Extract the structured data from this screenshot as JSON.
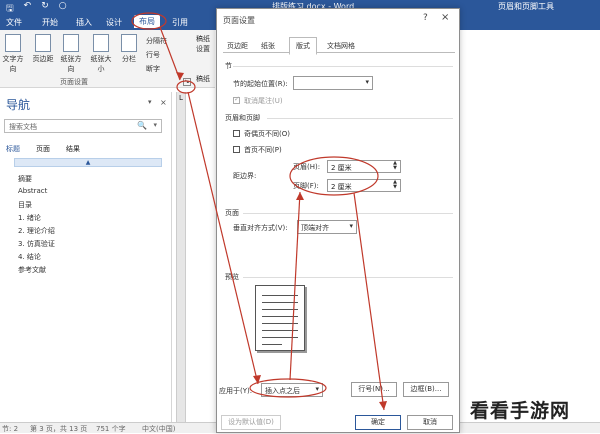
{
  "titlebar": {
    "quick_access": [
      "🖫",
      "↶",
      "↻",
      "○"
    ],
    "doc_title": "排版练习.docx - Word",
    "tools_title": "页眉和页脚工具"
  },
  "ribbon_tabs": [
    "文件",
    "开始",
    "插入",
    "设计",
    "布局",
    "引用"
  ],
  "ribbon": {
    "buttons": [
      "文字方向",
      "页边距",
      "纸张方向",
      "纸张大小",
      "分栏"
    ],
    "small_items": [
      "分隔符",
      "行号",
      "断字"
    ],
    "group_label": "页面设置",
    "launcher": "↘",
    "right_items": [
      "稿纸",
      "设置",
      "稿纸"
    ]
  },
  "nav": {
    "title": "导航",
    "pin": "▾",
    "close": "×",
    "search_placeholder": "搜索文档",
    "search_icon": "🔍",
    "search_dropdown": "▾",
    "tabs": [
      "标题",
      "页面",
      "结果"
    ],
    "bar_marker": "▲",
    "items": [
      "摘要",
      "Abstract",
      "目录",
      "1. 绪论",
      "2. 理论介绍",
      "3. 仿真验证",
      "4. 结论",
      "参考文献"
    ]
  },
  "ruler_mark": "L",
  "status": {
    "page": "第 3 页，共 13 页",
    "words": "751 个字",
    "lang": "中文(中国)",
    "left": "节: 2"
  },
  "dialog": {
    "title": "页面设置",
    "help": "?",
    "close": "×",
    "tabs": [
      "页边距",
      "纸张",
      "版式",
      "文档网格"
    ],
    "section_section": "节",
    "section_start_label": "节的起始位置(R):",
    "section_start_value": "",
    "suppress_endnotes": "取消尾注(U)",
    "headers_section": "页眉和页脚",
    "odd_even": "奇偶页不同(O)",
    "first_page": "首页不同(P)",
    "edge_label": "距边界:",
    "header_label": "页眉(H):",
    "header_value": "2 厘米",
    "footer_label": "页脚(F):",
    "footer_value": "2 厘米",
    "page_section": "页面",
    "valign_label": "垂直对齐方式(V):",
    "valign_value": "顶端对齐",
    "preview_section": "预览",
    "apply_label": "应用于(Y):",
    "apply_value": "插入点之后",
    "line_numbers_btn": "行号(N)...",
    "borders_btn": "边框(B)...",
    "default_btn": "设为默认值(D)",
    "ok_btn": "确定",
    "cancel_btn": "取消"
  },
  "watermark": "看看手游网",
  "colors": {
    "word_blue": "#2b579a",
    "annotation_red": "#c0392b"
  }
}
